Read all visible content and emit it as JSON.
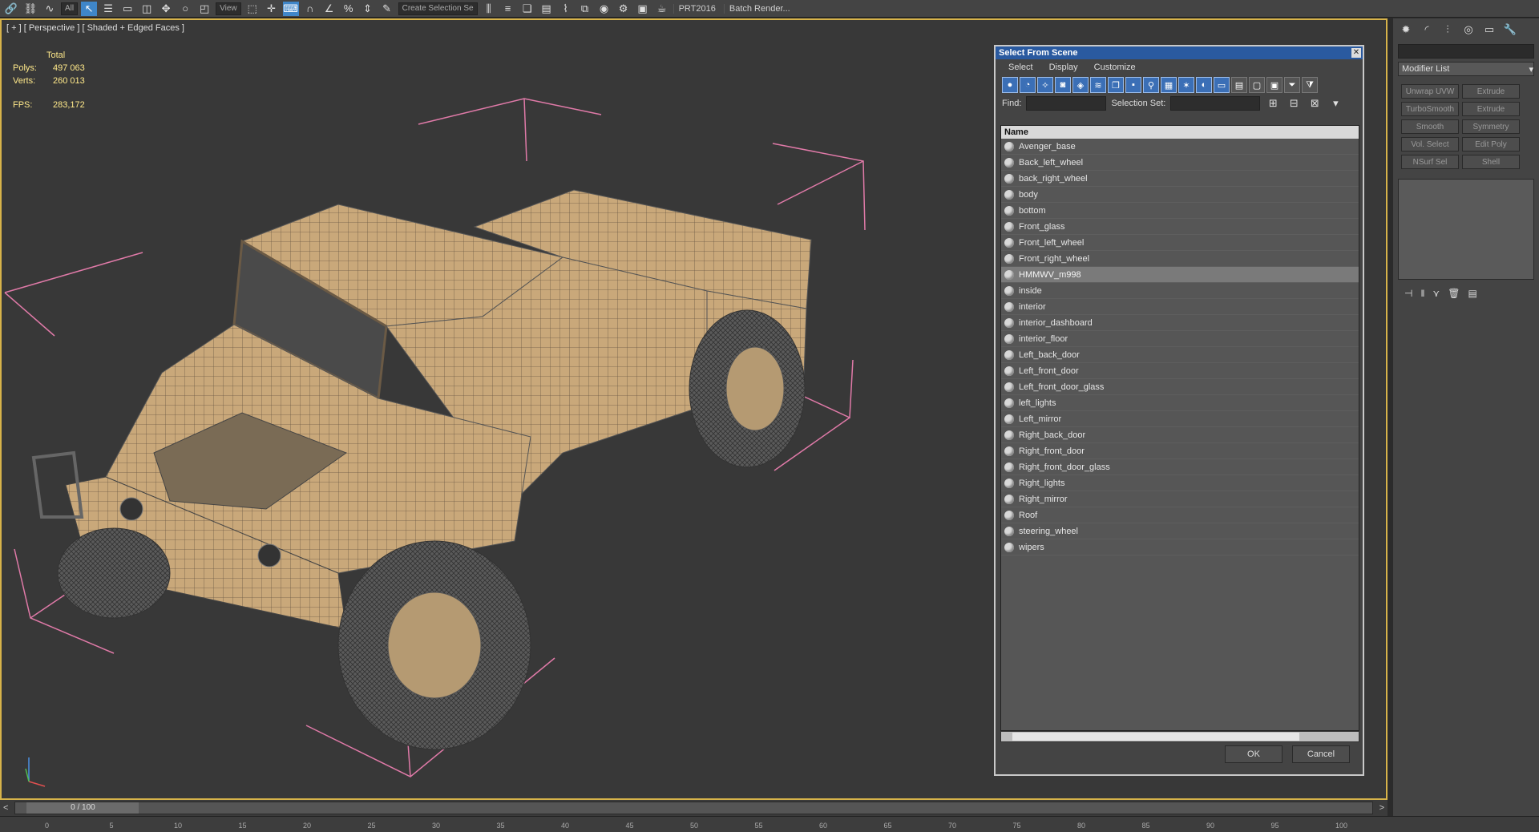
{
  "toolbar": {
    "selection_filter": "All",
    "view_dropdown": "View",
    "named_selection": "Create Selection Se",
    "prt_label": "PRT2016",
    "batch_render": "Batch Render..."
  },
  "viewport": {
    "label": "[ + ] [ Perspective ] [ Shaded + Edged Faces ]",
    "stats": {
      "total_label": "Total",
      "polys_label": "Polys:",
      "polys_value": "497 063",
      "verts_label": "Verts:",
      "verts_value": "260 013",
      "fps_label": "FPS:",
      "fps_value": "283,172"
    }
  },
  "dialog": {
    "title": "Select From Scene",
    "menu": [
      "Select",
      "Display",
      "Customize"
    ],
    "find_label": "Find:",
    "selection_set_label": "Selection Set:",
    "column_name": "Name",
    "items": [
      {
        "name": "Avenger_base"
      },
      {
        "name": "Back_left_wheel"
      },
      {
        "name": "back_right_wheel"
      },
      {
        "name": "body"
      },
      {
        "name": "bottom"
      },
      {
        "name": "Front_glass"
      },
      {
        "name": "Front_left_wheel"
      },
      {
        "name": "Front_right_wheel"
      },
      {
        "name": "HMMWV_m998",
        "selected": true
      },
      {
        "name": "inside"
      },
      {
        "name": "interior"
      },
      {
        "name": "interior_dashboard"
      },
      {
        "name": "interior_floor"
      },
      {
        "name": "Left_back_door"
      },
      {
        "name": "Left_front_door"
      },
      {
        "name": "Left_front_door_glass"
      },
      {
        "name": "left_lights"
      },
      {
        "name": "Left_mirror"
      },
      {
        "name": "Right_back_door"
      },
      {
        "name": "Right_front_door"
      },
      {
        "name": "Right_front_door_glass"
      },
      {
        "name": "Right_lights"
      },
      {
        "name": "Right_mirror"
      },
      {
        "name": "Roof"
      },
      {
        "name": "steering_wheel"
      },
      {
        "name": "wipers"
      }
    ],
    "ok_label": "OK",
    "cancel_label": "Cancel"
  },
  "command_panel": {
    "modifier_list": "Modifier List",
    "buttons": [
      "Unwrap UVW",
      "Extrude",
      "TurboSmooth",
      "Extrude",
      "Smooth",
      "Symmetry",
      "Vol. Select",
      "Edit Poly",
      "NSurf Sel",
      "Shell"
    ]
  },
  "timeline": {
    "frame": "0 / 100",
    "ticks": [
      "0",
      "5",
      "10",
      "15",
      "20",
      "25",
      "30",
      "35",
      "40",
      "45",
      "50",
      "55",
      "60",
      "65",
      "70",
      "75",
      "80",
      "85",
      "90",
      "95",
      "100"
    ]
  },
  "colors": {
    "viewport_border": "#d7b34a",
    "stats_text": "#ffe98a",
    "dialog_title": "#2a5aa0",
    "bbox_lines": "#e07aa8",
    "model_tan": "#c9a87a"
  }
}
